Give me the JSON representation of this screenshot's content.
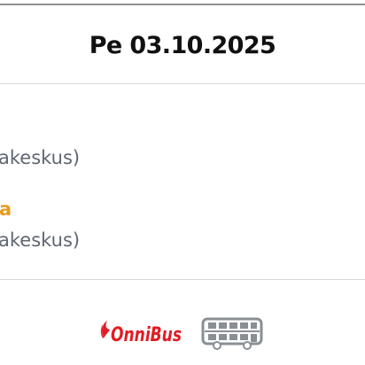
{
  "header": {
    "date": "Pe 03.10.2025"
  },
  "details": {
    "line1_text": "akeskus)",
    "accent_text": "a",
    "line2_text": "akeskus)"
  },
  "footer": {
    "brand": "OnniBus",
    "bus_icon": "double-decker-bus-icon"
  },
  "colors": {
    "title": "#111111",
    "secondary_text": "#5f6673",
    "accent": "#e59c1f",
    "brand_red": "#e31b23",
    "bus_gray": "#8a8f94",
    "divider": "#d7d7d7"
  }
}
